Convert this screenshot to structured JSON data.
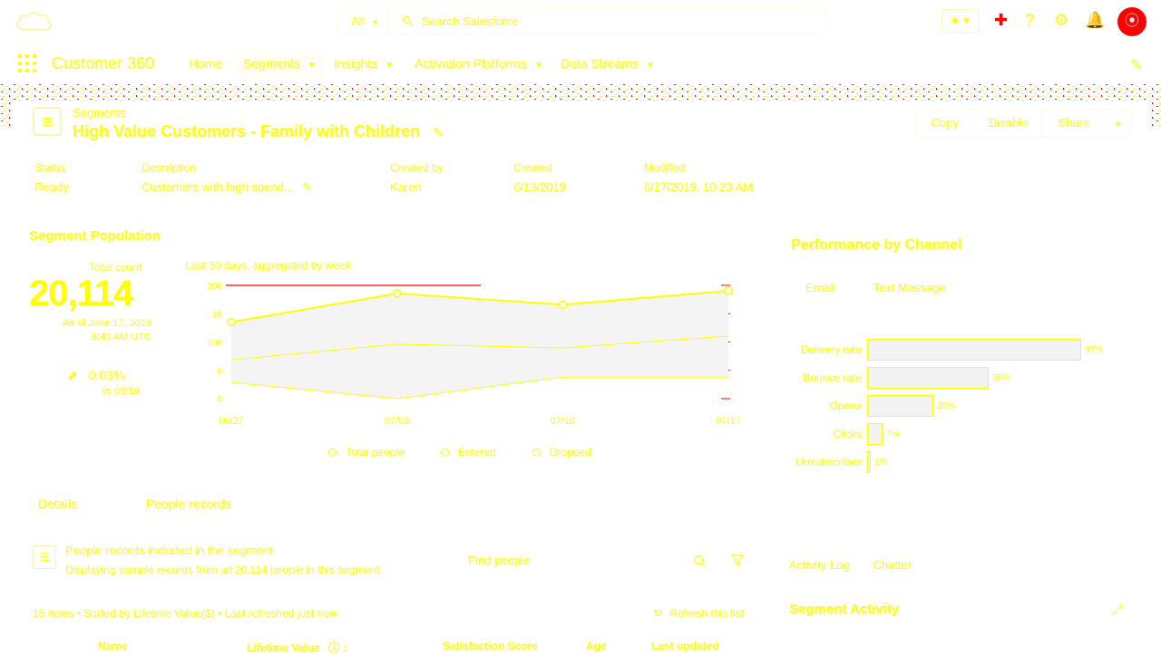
{
  "header": {
    "search_scope": "All",
    "search_placeholder": "Search Salesforce",
    "icons": [
      "favorites-icon",
      "add-icon",
      "help-icon",
      "setup-gear-icon",
      "notifications-bell-icon"
    ],
    "avatar_icon": "user-avatar"
  },
  "nav": {
    "app_name": "Customer 360",
    "items": [
      {
        "label": "Home",
        "has_menu": false
      },
      {
        "label": "Segments",
        "has_menu": true,
        "active": true
      },
      {
        "label": "Insights",
        "has_menu": true
      },
      {
        "label": "Activation Platforms",
        "has_menu": true
      },
      {
        "label": "Data Streams",
        "has_menu": true
      }
    ]
  },
  "record": {
    "object_type": "Segments",
    "title": "High Value Customers - Family with Children",
    "buttons": [
      "Copy",
      "Disable",
      "Share"
    ],
    "fields": [
      {
        "label": "Status",
        "value": "Ready"
      },
      {
        "label": "Description",
        "value": "Customers with high spend..."
      },
      {
        "label": "Created by",
        "value": "Karen"
      },
      {
        "label": "Created",
        "value": "6/13/2019"
      },
      {
        "label": "Modified",
        "value": "6/17/2019, 10:23 AM"
      }
    ]
  },
  "population": {
    "title": "Segment Population",
    "total_label": "Total count",
    "total_value": "20,114",
    "as_of_line1": "As of June 17, 2019",
    "as_of_line2": "8:40 AM UTC",
    "change_pct": "0.03%",
    "change_note": "vs 06/16",
    "chart_subtitle": "Last 30 days, aggregated by week",
    "legend": [
      "Total people",
      "Entered",
      "Dropped"
    ]
  },
  "chart_data": {
    "type": "line",
    "x": [
      "06/27",
      "07/03",
      "07/10",
      "07/17"
    ],
    "ytick_labels": [
      "0",
      "0",
      "100",
      "15",
      "200"
    ],
    "series": [
      {
        "name": "Total people",
        "values": [
          102,
          155,
          134,
          160
        ]
      },
      {
        "name": "Entered",
        "values": [
          32,
          61,
          54,
          76
        ]
      },
      {
        "name": "Dropped",
        "values": [
          -10,
          -40,
          0,
          0
        ]
      }
    ],
    "ylim": [
      -40,
      170
    ]
  },
  "people": {
    "tabs": [
      "Details",
      "People records"
    ],
    "active_tab": "People records",
    "section_title": "People records included in the segment",
    "section_sub": "Displaying sample records from all 20,114 people in this segment.",
    "search_placeholder": "Find people",
    "summary": "15 items • Sorted by Lifetime Value($) • Last refreshed just now",
    "refresh_label": "Refresh this list",
    "columns": [
      "Name",
      "Lifetime Value",
      "Satisfaction Score",
      "Age",
      "Last updated"
    ]
  },
  "performance": {
    "title": "Performance by Channel",
    "tabs": [
      "Email",
      "Text Message"
    ],
    "active_tab": "Email",
    "metrics": [
      {
        "label": "Delivery rate",
        "value": 0.97,
        "text": "97%"
      },
      {
        "label": "Bounce rate",
        "value": 0.55,
        "text": "55%"
      },
      {
        "label": "Opens",
        "value": 0.3,
        "text": "30%"
      },
      {
        "label": "Clicks",
        "value": 0.07,
        "text": "7%"
      },
      {
        "label": "Unsubscribes",
        "value": 0.01,
        "text": "1%"
      }
    ]
  },
  "activity": {
    "tabs": [
      "Activity Log",
      "Chatter"
    ],
    "active_tab": "Activity Log",
    "title": "Segment Activity"
  },
  "colors": {
    "text": "#ffff00",
    "accent": "#ff0000",
    "background": "#ffffff"
  }
}
